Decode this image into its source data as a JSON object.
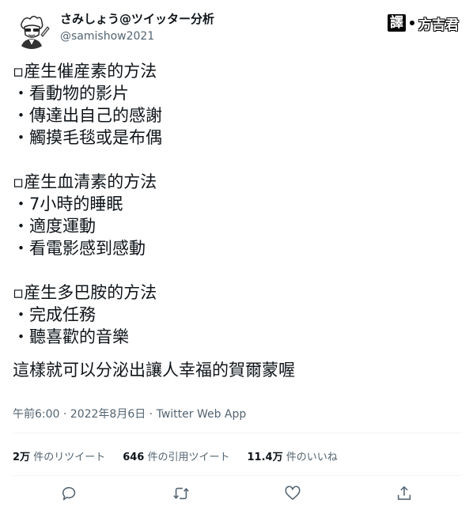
{
  "author": {
    "display_name": "さみしょう@ツイッター分析",
    "handle": "@samishow2021"
  },
  "watermark": {
    "box_label": "譯",
    "name": "方吉君"
  },
  "tweet": {
    "lines": [
      "▫産生催産素的方法",
      "・看動物的影片",
      "・傳達出自己的感謝",
      "・觸摸毛毯或是布偶",
      "",
      "▫産生血清素的方法",
      "・7小時的睡眠",
      "・適度運動",
      "・看電影感到感動",
      "",
      "▫産生多巴胺的方法",
      "・完成任務",
      "・聽喜歡的音樂"
    ],
    "closing": "這樣就可以分泌出讓人幸福的賀爾蒙喔",
    "meta": "午前6:00 · 2022年8月6日 · Twitter Web App"
  },
  "stats": {
    "retweets_count": "2万",
    "retweets_label": "件のリツイート",
    "quotes_count": "646",
    "quotes_label": "件の引用ツイート",
    "likes_count": "11.4万",
    "likes_label": "件のいいね"
  },
  "icons": [
    "reply-icon",
    "retweet-icon",
    "like-icon",
    "share-icon"
  ],
  "colors": {
    "text": "#0f1419",
    "secondary": "#536471",
    "divider": "#eff3f4"
  }
}
